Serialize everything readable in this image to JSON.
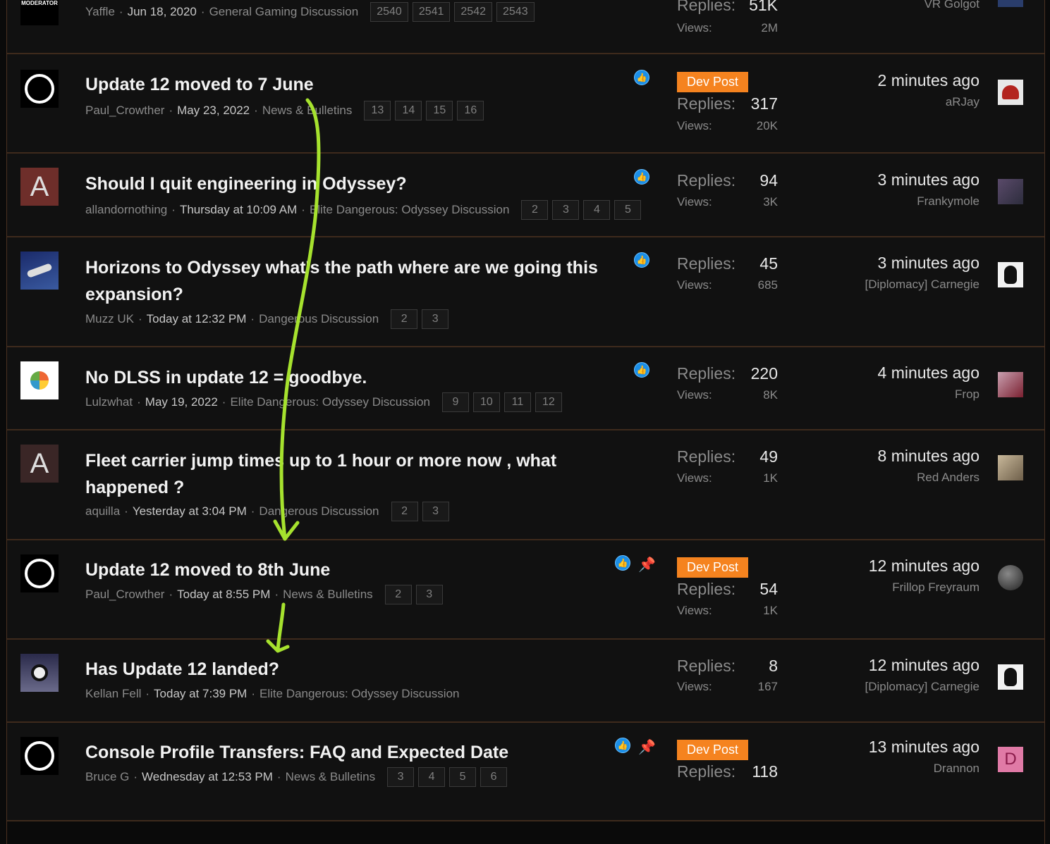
{
  "threads": [
    {
      "author": "Yaffle",
      "date": "Jun 18, 2020",
      "forum": "General Gaming Discussion",
      "pages": [
        "2540",
        "2541",
        "2542",
        "2543"
      ],
      "avatar_label": "MODERATOR",
      "replies_label": "Replies:",
      "replies": "51K",
      "views_label": "Views:",
      "views": "2M",
      "last_user": "VR Golgot"
    },
    {
      "title": "Update 12 moved to 7 June",
      "author": "Paul_Crowther",
      "date": "May 23, 2022",
      "forum": "News & Bulletins",
      "pages": [
        "13",
        "14",
        "15",
        "16"
      ],
      "dev_post": "Dev Post",
      "replies_label": "Replies:",
      "replies": "317",
      "views_label": "Views:",
      "views": "20K",
      "last_time": "2 minutes ago",
      "last_user": "aRJay"
    },
    {
      "title": "Should I quit engineering in Odyssey?",
      "author": "allandornothing",
      "date": "Thursday at 10:09 AM",
      "forum": "Elite Dangerous: Odyssey Discussion",
      "pages": [
        "2",
        "3",
        "4",
        "5"
      ],
      "avatar_letter": "A",
      "replies_label": "Replies:",
      "replies": "94",
      "views_label": "Views:",
      "views": "3K",
      "last_time": "3 minutes ago",
      "last_user": "Frankymole"
    },
    {
      "title": "Horizons to Odyssey what's the path where are we going this expansion?",
      "author": "Muzz UK",
      "date": "Today at 12:32 PM",
      "forum": "Dangerous Discussion",
      "pages": [
        "2",
        "3"
      ],
      "replies_label": "Replies:",
      "replies": "45",
      "views_label": "Views:",
      "views": "685",
      "last_time": "3 minutes ago",
      "last_user": "[Diplomacy] Carnegie"
    },
    {
      "title": "No DLSS in update 12 = goodbye.",
      "author": "Lulzwhat",
      "date": "May 19, 2022",
      "forum": "Elite Dangerous: Odyssey Discussion",
      "pages": [
        "9",
        "10",
        "11",
        "12"
      ],
      "replies_label": "Replies:",
      "replies": "220",
      "views_label": "Views:",
      "views": "8K",
      "last_time": "4 minutes ago",
      "last_user": "Frop"
    },
    {
      "title": "Fleet carrier jump times up to 1 hour or more now , what happened ?",
      "author": "aquilla",
      "date": "Yesterday at 3:04 PM",
      "forum": "Dangerous Discussion",
      "pages": [
        "2",
        "3"
      ],
      "avatar_letter": "A",
      "replies_label": "Replies:",
      "replies": "49",
      "views_label": "Views:",
      "views": "1K",
      "last_time": "8 minutes ago",
      "last_user": "Red Anders"
    },
    {
      "title": "Update 12 moved to 8th June",
      "author": "Paul_Crowther",
      "date": "Today at 8:55 PM",
      "forum": "News & Bulletins",
      "pages": [
        "2",
        "3"
      ],
      "dev_post": "Dev Post",
      "replies_label": "Replies:",
      "replies": "54",
      "views_label": "Views:",
      "views": "1K",
      "last_time": "12 minutes ago",
      "last_user": "Frillop Freyraum"
    },
    {
      "title": "Has Update 12 landed?",
      "author": "Kellan Fell",
      "date": "Today at 7:39 PM",
      "forum": "Elite Dangerous: Odyssey Discussion",
      "replies_label": "Replies:",
      "replies": "8",
      "views_label": "Views:",
      "views": "167",
      "last_time": "12 minutes ago",
      "last_user": "[Diplomacy] Carnegie"
    },
    {
      "title": "Console Profile Transfers: FAQ and Expected Date",
      "author": "Bruce G",
      "date": "Wednesday at 12:53 PM",
      "forum": "News & Bulletins",
      "pages": [
        "3",
        "4",
        "5",
        "6"
      ],
      "dev_post": "Dev Post",
      "replies_label": "Replies:",
      "replies": "118",
      "last_time": "13 minutes ago",
      "last_user": "Drannon",
      "last_avatar_letter": "D"
    }
  ],
  "colors": {
    "dev_post": "#f5831f",
    "like": "#1b8fe8",
    "annotation_arrow": "#a6e22e",
    "row_border": "#3e2a1c",
    "row_bg": "#111111"
  },
  "icons": {
    "like": "thumbs-up-icon",
    "pin": "pin-icon",
    "avatar": "ring-logo"
  }
}
